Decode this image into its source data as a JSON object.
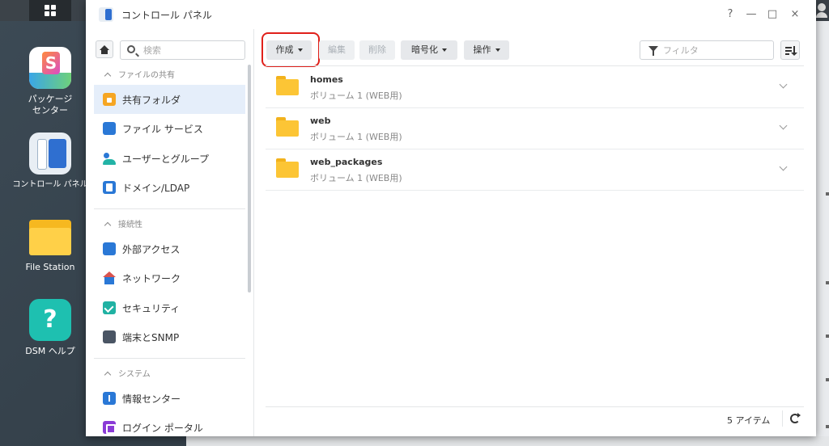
{
  "window": {
    "title": "コントロール パネル",
    "controls": {
      "help": "?",
      "minimize": "—",
      "maximize": "□",
      "close": "×"
    }
  },
  "desktop": {
    "items": [
      {
        "label": "パッケージ\nセンター",
        "icon": "package-center-icon"
      },
      {
        "label": "コントロール パネル",
        "icon": "control-panel-icon"
      },
      {
        "label": "File Station",
        "icon": "file-station-icon"
      },
      {
        "label": "DSM ヘルプ",
        "icon": "help-icon"
      }
    ]
  },
  "sidebar": {
    "search_placeholder": "検索",
    "groups": [
      {
        "title": "ファイルの共有",
        "items": [
          {
            "label": "共有フォルダ",
            "icon": "shared-folder-icon",
            "active": true
          },
          {
            "label": "ファイル サービス",
            "icon": "file-services-icon"
          },
          {
            "label": "ユーザーとグループ",
            "icon": "users-groups-icon"
          },
          {
            "label": "ドメイン/LDAP",
            "icon": "domain-ldap-icon"
          }
        ]
      },
      {
        "title": "接続性",
        "items": [
          {
            "label": "外部アクセス",
            "icon": "external-access-icon"
          },
          {
            "label": "ネットワーク",
            "icon": "network-icon"
          },
          {
            "label": "セキュリティ",
            "icon": "security-icon"
          },
          {
            "label": "端末とSNMP",
            "icon": "terminal-snmp-icon"
          }
        ]
      },
      {
        "title": "システム",
        "items": [
          {
            "label": "情報センター",
            "icon": "info-center-icon"
          },
          {
            "label": "ログイン ポータル",
            "icon": "login-portal-icon"
          }
        ]
      }
    ]
  },
  "toolbar": {
    "create": "作成",
    "edit": "編集",
    "delete": "削除",
    "encrypt": "暗号化",
    "action": "操作",
    "filter_placeholder": "フィルタ"
  },
  "folders": [
    {
      "name": "homes",
      "location": "ボリューム 1 (WEB用)"
    },
    {
      "name": "web",
      "location": "ボリューム 1 (WEB用)"
    },
    {
      "name": "web_packages",
      "location": "ボリューム 1 (WEB用)"
    }
  ],
  "footer": {
    "count": "5 アイテム"
  },
  "colors": {
    "accent": "#2a78d6",
    "active_bg": "#e5eefa",
    "highlight": "#e0201a",
    "folder": "#fcc535"
  }
}
